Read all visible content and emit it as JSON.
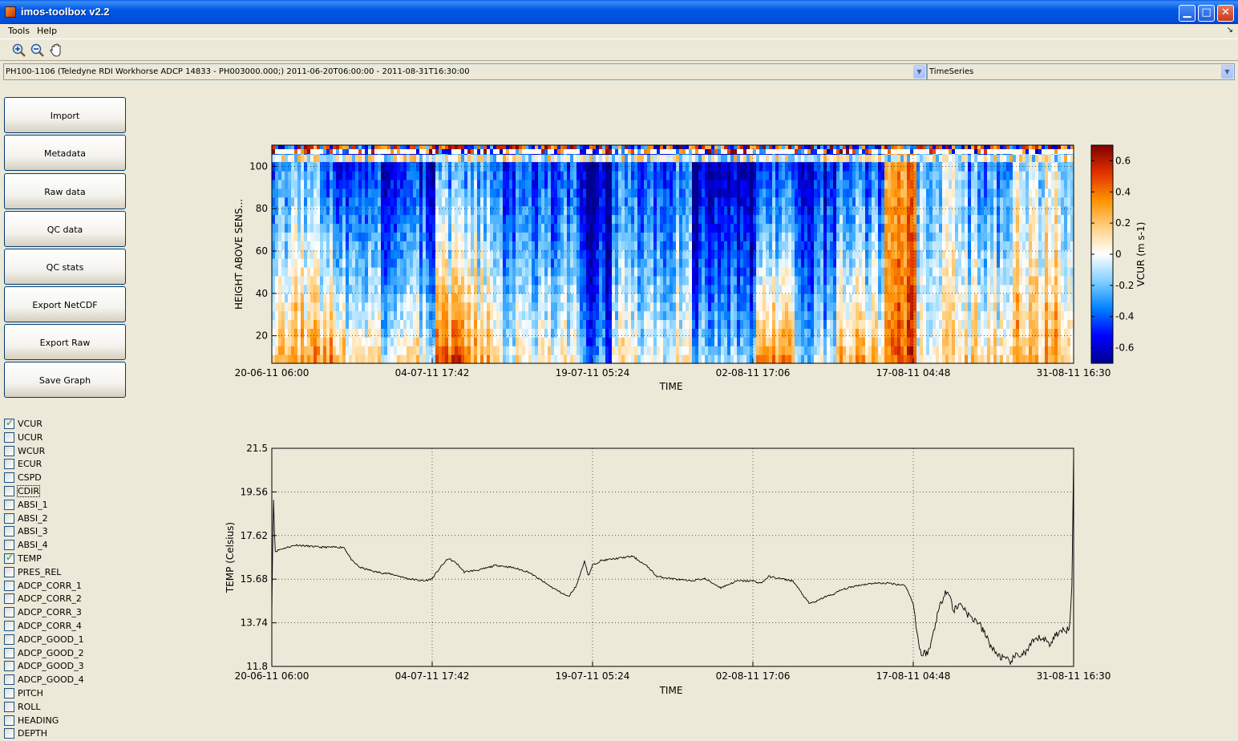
{
  "window": {
    "title": "imos-toolbox v2.2",
    "controls": [
      "minimize",
      "maximize",
      "close"
    ]
  },
  "menu": {
    "items": [
      "Tools",
      "Help"
    ]
  },
  "toolbar": {
    "icons": [
      "zoom-in-icon",
      "zoom-out-icon",
      "pan-hand-icon"
    ]
  },
  "dataset_select": {
    "value": "PH100-1106 (Teledyne RDI Workhorse ADCP 14833 - PH003000.000;) 2011-06-20T06:00:00 - 2011-08-31T16:30:00"
  },
  "graph_type_select": {
    "value": "TimeSeries"
  },
  "sidebar": {
    "buttons": [
      "Import",
      "Metadata",
      "Raw data",
      "QC data",
      "QC stats",
      "Export NetCDF",
      "Export Raw",
      "Save Graph"
    ]
  },
  "variables": [
    {
      "name": "VCUR",
      "checked": true
    },
    {
      "name": "UCUR",
      "checked": false
    },
    {
      "name": "WCUR",
      "checked": false
    },
    {
      "name": "ECUR",
      "checked": false
    },
    {
      "name": "CSPD",
      "checked": false
    },
    {
      "name": "CDIR",
      "checked": false
    },
    {
      "name": "ABSI_1",
      "checked": false
    },
    {
      "name": "ABSI_2",
      "checked": false
    },
    {
      "name": "ABSI_3",
      "checked": false
    },
    {
      "name": "ABSI_4",
      "checked": false
    },
    {
      "name": "TEMP",
      "checked": true
    },
    {
      "name": "PRES_REL",
      "checked": false
    },
    {
      "name": "ADCP_CORR_1",
      "checked": false
    },
    {
      "name": "ADCP_CORR_2",
      "checked": false
    },
    {
      "name": "ADCP_CORR_3",
      "checked": false
    },
    {
      "name": "ADCP_CORR_4",
      "checked": false
    },
    {
      "name": "ADCP_GOOD_1",
      "checked": false
    },
    {
      "name": "ADCP_GOOD_2",
      "checked": false
    },
    {
      "name": "ADCP_GOOD_3",
      "checked": false
    },
    {
      "name": "ADCP_GOOD_4",
      "checked": false
    },
    {
      "name": "PITCH",
      "checked": false
    },
    {
      "name": "ROLL",
      "checked": false
    },
    {
      "name": "HEADING",
      "checked": false
    },
    {
      "name": "DEPTH",
      "checked": false
    }
  ],
  "chart_data": [
    {
      "type": "heatmap",
      "xlabel": "TIME",
      "ylabel": "HEIGHT ABOVE SENS...",
      "x_ticks": [
        "20-06-11 06:00",
        "04-07-11 17:42",
        "19-07-11 05:24",
        "02-08-11 17:06",
        "17-08-11 04:48",
        "31-08-11 16:30"
      ],
      "y_ticks": [
        20,
        40,
        60,
        80,
        100
      ],
      "ylim": [
        7,
        110
      ],
      "colorbar": {
        "label": "VCUR (m s-1)",
        "ticks": [
          "0.6",
          "0.4",
          "0.2",
          "0",
          "-0.2",
          "-0.4",
          "-0.6"
        ],
        "range": [
          -0.7,
          0.7
        ],
        "colormap": [
          "#00008f",
          "#0000ff",
          "#0080ff",
          "#80d0ff",
          "#ffffff",
          "#ffd080",
          "#ff9000",
          "#e03000",
          "#800000"
        ]
      },
      "grid": true,
      "profile_segments": [
        {
          "x": [
            0,
            0.06
          ],
          "v_top": -0.3,
          "v_bottom": 0.25
        },
        {
          "x": [
            0.06,
            0.09
          ],
          "v_top": -0.45,
          "v_bottom": 0.35
        },
        {
          "x": [
            0.09,
            0.2
          ],
          "v_top": -0.55,
          "v_bottom": 0.05
        },
        {
          "x": [
            0.2,
            0.24
          ],
          "v_top": -0.35,
          "v_bottom": 0.4
        },
        {
          "x": [
            0.24,
            0.28
          ],
          "v_top": -0.3,
          "v_bottom": 0.25
        },
        {
          "x": [
            0.28,
            0.38
          ],
          "v_top": -0.45,
          "v_bottom": 0.05
        },
        {
          "x": [
            0.38,
            0.42
          ],
          "v_top": -0.65,
          "v_bottom": -0.3
        },
        {
          "x": [
            0.42,
            0.52
          ],
          "v_top": -0.4,
          "v_bottom": 0.05
        },
        {
          "x": [
            0.52,
            0.6
          ],
          "v_top": -0.65,
          "v_bottom": -0.15
        },
        {
          "x": [
            0.6,
            0.65
          ],
          "v_top": -0.5,
          "v_bottom": 0.3
        },
        {
          "x": [
            0.65,
            0.7
          ],
          "v_top": -0.55,
          "v_bottom": -0.1
        },
        {
          "x": [
            0.7,
            0.76
          ],
          "v_top": -0.4,
          "v_bottom": 0.25
        },
        {
          "x": [
            0.76,
            0.8
          ],
          "v_top": 0.3,
          "v_bottom": 0.45
        },
        {
          "x": [
            0.8,
            0.86
          ],
          "v_top": -0.15,
          "v_bottom": 0.1
        },
        {
          "x": [
            0.86,
            0.92
          ],
          "v_top": -0.3,
          "v_bottom": 0.15
        },
        {
          "x": [
            0.92,
            1.0
          ],
          "v_top": -0.1,
          "v_bottom": 0.25
        }
      ]
    },
    {
      "type": "line",
      "xlabel": "TIME",
      "ylabel": "TEMP (Celsius)",
      "x_ticks": [
        "20-06-11 06:00",
        "04-07-11 17:42",
        "19-07-11 05:24",
        "02-08-11 17:06",
        "17-08-11 04:48",
        "31-08-11 16:30"
      ],
      "y_ticks": [
        "11.8",
        "13.74",
        "15.68",
        "17.62",
        "19.56",
        "21.5"
      ],
      "ylim": [
        11.8,
        21.5
      ],
      "grid": true,
      "series": [
        {
          "x_frac": [
            0,
            0.002,
            0.004,
            0.01,
            0.03,
            0.06,
            0.09,
            0.1,
            0.11,
            0.13,
            0.15,
            0.17,
            0.19,
            0.2,
            0.21,
            0.22,
            0.23,
            0.24,
            0.26,
            0.28,
            0.3,
            0.32,
            0.35,
            0.37,
            0.38,
            0.39,
            0.395,
            0.4,
            0.41,
            0.43,
            0.45,
            0.47,
            0.48,
            0.5,
            0.52,
            0.54,
            0.56,
            0.58,
            0.6,
            0.61,
            0.62,
            0.65,
            0.67,
            0.68,
            0.69,
            0.7,
            0.71,
            0.73,
            0.75,
            0.77,
            0.79,
            0.8,
            0.805,
            0.81,
            0.82,
            0.83,
            0.84,
            0.845,
            0.85,
            0.86,
            0.87,
            0.88,
            0.89,
            0.9,
            0.91,
            0.92,
            0.93,
            0.94,
            0.95,
            0.96,
            0.97,
            0.98,
            0.99,
            0.995,
            0.998,
            1.0
          ],
          "values": [
            14.2,
            19.5,
            16.9,
            17.0,
            17.2,
            17.1,
            17.1,
            16.5,
            16.2,
            16.0,
            15.9,
            15.7,
            15.6,
            15.7,
            16.2,
            16.6,
            16.4,
            16.0,
            16.1,
            16.3,
            16.2,
            16.0,
            15.3,
            14.9,
            15.4,
            16.5,
            15.8,
            16.3,
            16.5,
            16.6,
            16.7,
            16.2,
            15.8,
            15.7,
            15.6,
            15.7,
            15.3,
            15.6,
            15.6,
            15.5,
            15.8,
            15.6,
            14.6,
            14.7,
            14.9,
            15.0,
            15.2,
            15.4,
            15.5,
            15.5,
            15.4,
            14.6,
            13.2,
            12.3,
            12.5,
            14.1,
            15.2,
            15.0,
            14.3,
            14.6,
            14.0,
            13.8,
            13.2,
            12.5,
            12.2,
            12.0,
            12.3,
            12.4,
            12.9,
            13.1,
            12.8,
            13.3,
            13.4,
            13.6,
            15.5,
            21.3
          ]
        }
      ]
    }
  ]
}
